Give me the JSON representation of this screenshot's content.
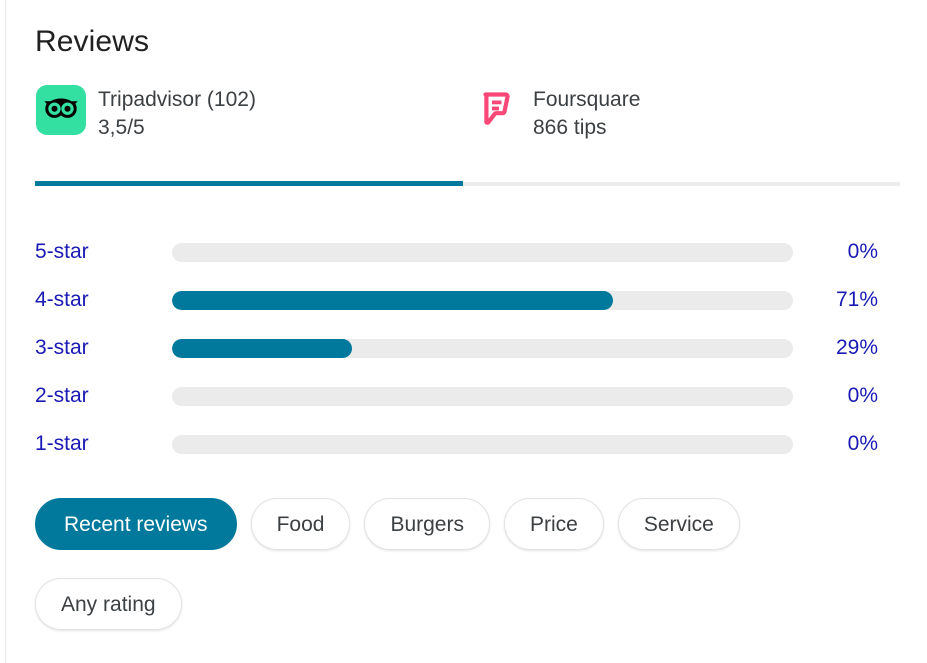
{
  "header": {
    "title": "Reviews"
  },
  "sources": [
    {
      "icon": "tripadvisor-icon",
      "name": "Tripadvisor (102)",
      "detail": "3,5/5",
      "active": true,
      "brand_color": "#34E0A1"
    },
    {
      "icon": "foursquare-icon",
      "name": "Foursquare",
      "detail": "866 tips",
      "active": false,
      "brand_color": "#F94877"
    }
  ],
  "tab_indicator": {
    "active_color": "#00799c",
    "track_color": "#ececec"
  },
  "ratings": {
    "rows": [
      {
        "label": "5-star",
        "percent": 0,
        "percent_text": "0%"
      },
      {
        "label": "4-star",
        "percent": 71,
        "percent_text": "71%"
      },
      {
        "label": "3-star",
        "percent": 29,
        "percent_text": "29%"
      },
      {
        "label": "2-star",
        "percent": 0,
        "percent_text": "0%"
      },
      {
        "label": "1-star",
        "percent": 0,
        "percent_text": "0%"
      }
    ],
    "fill_color": "#00799c",
    "track_color": "#ebebeb",
    "text_color": "#1a1ab4"
  },
  "filters": {
    "chips": [
      {
        "label": "Recent reviews",
        "selected": true
      },
      {
        "label": "Food",
        "selected": false
      },
      {
        "label": "Burgers",
        "selected": false
      },
      {
        "label": "Price",
        "selected": false
      },
      {
        "label": "Service",
        "selected": false
      },
      {
        "label": "Any rating",
        "selected": false,
        "new_row": true
      }
    ],
    "selected_color": "#00799c"
  },
  "chart_data": {
    "type": "bar",
    "title": "Reviews",
    "orientation": "horizontal",
    "categories": [
      "5-star",
      "4-star",
      "3-star",
      "2-star",
      "1-star"
    ],
    "values": [
      0,
      71,
      29,
      0,
      0
    ],
    "value_labels": [
      "0%",
      "71%",
      "29%",
      "0%",
      "0%"
    ],
    "xlabel": "",
    "ylabel": "",
    "xlim": [
      0,
      100
    ],
    "grid": false,
    "legend": "none",
    "unit": "%"
  }
}
